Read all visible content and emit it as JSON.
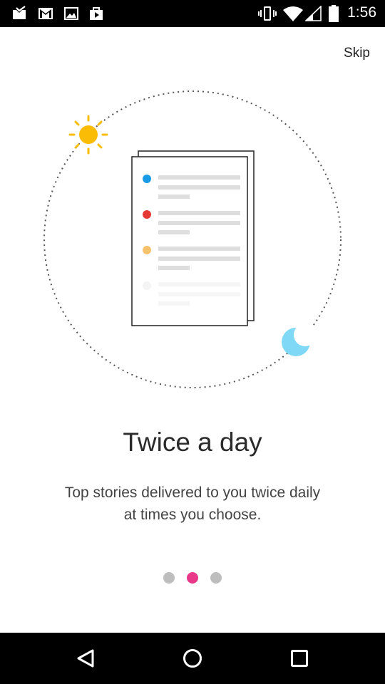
{
  "status_bar": {
    "time": "1:56",
    "notification_icons": [
      "inbox-icon",
      "gmail-icon",
      "image-icon",
      "play-store-icon"
    ],
    "system_icons": [
      "vibrate-icon",
      "wifi-icon",
      "signal-icon",
      "battery-icon"
    ]
  },
  "onboarding": {
    "skip_label": "Skip",
    "title": "Twice a day",
    "subtitle_line1": "Top stories delivered to you twice daily",
    "subtitle_line2": "at times you choose.",
    "page_count": 3,
    "current_page": 2
  },
  "illustration": {
    "icons": [
      "sun-icon",
      "moon-icon",
      "document-icon"
    ],
    "bullet_colors": [
      "#1a9be6",
      "#e53935",
      "#f6c26b",
      "#f4f4f4"
    ],
    "sun_color": "#fbbc05",
    "moon_color": "#7fd8f5"
  },
  "colors": {
    "accent": "#e8388a",
    "dot_inactive": "#bdbdbd"
  },
  "nav_bar": {
    "buttons": [
      "back-icon",
      "home-icon",
      "recents-icon"
    ]
  }
}
